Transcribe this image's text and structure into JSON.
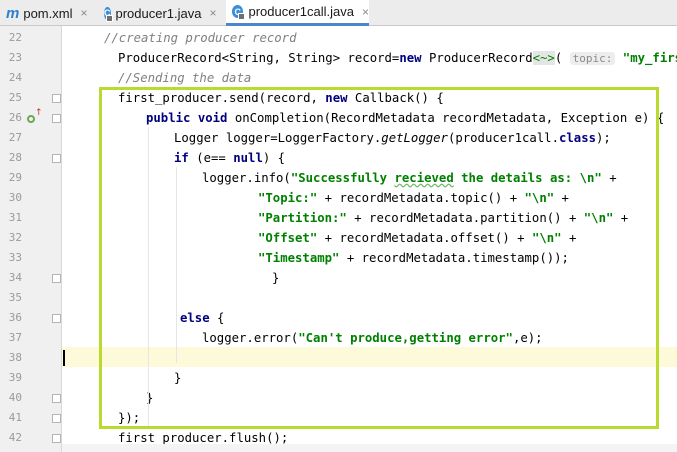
{
  "tabs": [
    {
      "label": "pom.xml",
      "icon": "maven-icon",
      "close": "×"
    },
    {
      "label": "producer1.java",
      "icon": "java-class-icon",
      "close": "×"
    },
    {
      "label": "producer1call.java",
      "icon": "java-class-icon",
      "close": "×",
      "active": true
    }
  ],
  "gutter": {
    "line_numbers": [
      "22",
      "23",
      "24",
      "25",
      "26",
      "27",
      "28",
      "29",
      "30",
      "31",
      "32",
      "33",
      "34",
      "35",
      "36",
      "37",
      "38",
      "39",
      "40",
      "41",
      "42"
    ]
  },
  "code": {
    "l22": "//creating producer record",
    "l23a": "ProducerRecord<String, String> record=",
    "l23b": "new",
    "l23c": " ProducerRecord",
    "l23d": "<~>",
    "l23e": "( ",
    "l23hint": "topic:",
    "l23f": " ",
    "l23g": "\"my_first\"",
    "l23h": ",",
    "l24": "//Sending the data",
    "l25a": "first_producer.send(record, ",
    "l25b": "new",
    "l25c": " Callback() {",
    "l26a": "public void",
    "l26b": " onCompletion(RecordMetadata recordMetadata, Exception e) {",
    "l27a": "Logger logger=LoggerFactory.",
    "l27b": "getLogger",
    "l27c": "(producer1call.",
    "l27d": "class",
    "l27e": ");",
    "l28a": "if",
    "l28b": " (e== ",
    "l28c": "null",
    "l28d": ") {",
    "l29a": "logger.info(",
    "l29b": "\"Successfully ",
    "l29c": "recieved",
    "l29d": " the details as: \\n\"",
    "l29e": " +",
    "l30a": "\"Topic:\"",
    "l30b": " + recordMetadata.topic() + ",
    "l30c": "\"\\n\"",
    "l30d": " +",
    "l31a": "\"Partition:\"",
    "l31b": " + recordMetadata.partition() + ",
    "l31c": "\"\\n\"",
    "l31d": " +",
    "l32a": "\"Offset\"",
    "l32b": " + recordMetadata.offset() + ",
    "l32c": "\"\\n\"",
    "l32d": " +",
    "l33a": "\"Timestamp\"",
    "l33b": " + recordMetadata.timestamp());",
    "l34": "}",
    "l36a": "else",
    "l36b": " {",
    "l37a": "logger.error(",
    "l37b": "\"Can't produce,getting error\"",
    "l37c": ",e);",
    "l39": "}",
    "l40": "}",
    "l41": "});",
    "l42": "first_producer.flush();"
  },
  "colors": {
    "keyword": "#000080",
    "string": "#008000",
    "comment": "#808080",
    "selection_box": "#b9da2f",
    "active_tab_underline": "#4a88c7"
  }
}
